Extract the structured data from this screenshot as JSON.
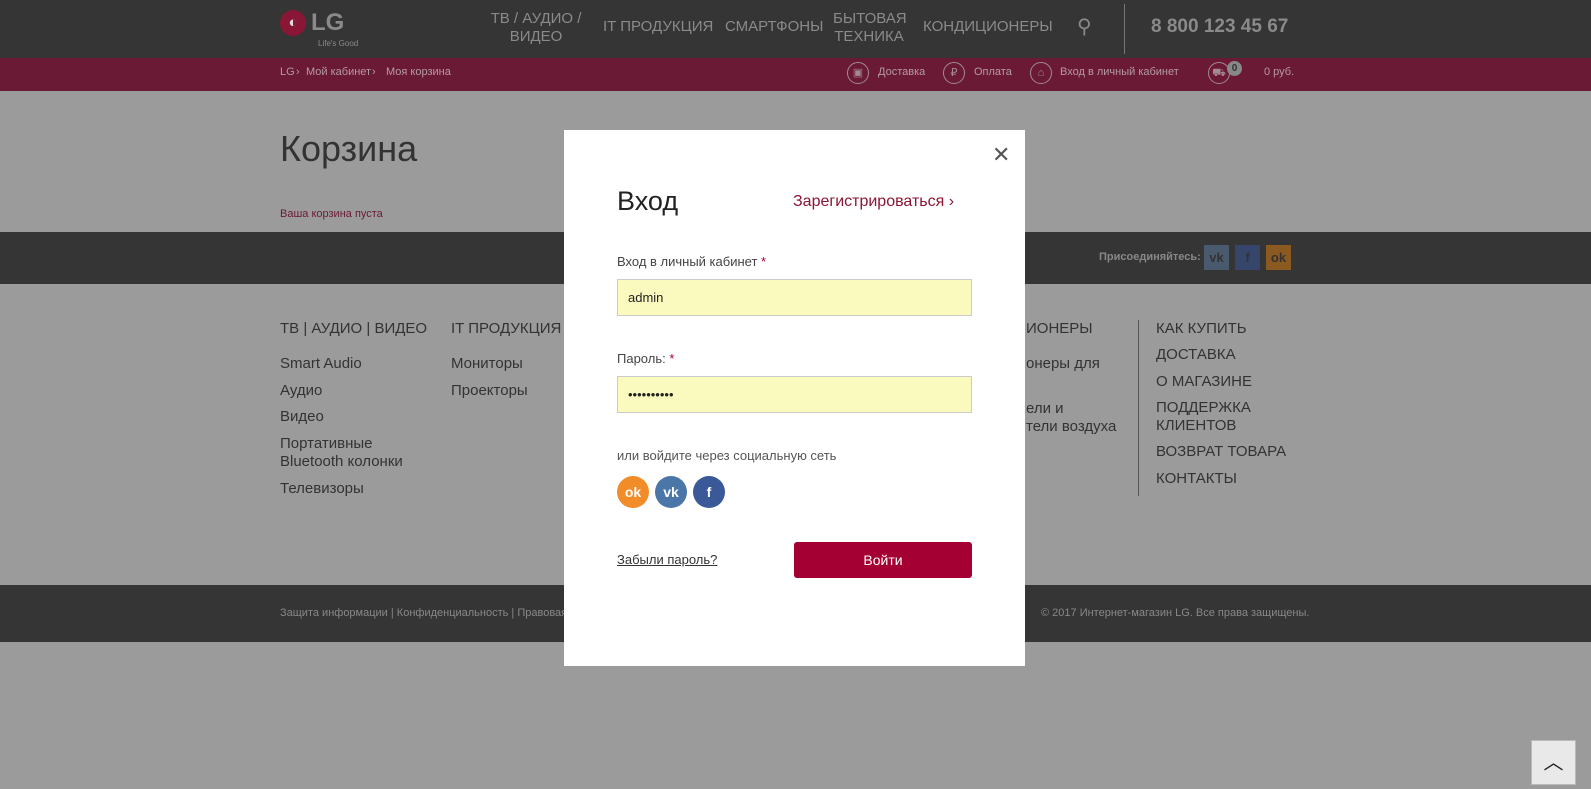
{
  "header": {
    "logo": "LG",
    "logo_tagline": "Life's Good",
    "nav": [
      "ТВ / АУДИО / ВИДЕО",
      "IT ПРОДУКЦИЯ",
      "СМАРТФОНЫ",
      "БЫТОВАЯ ТЕХНИКА",
      "КОНДИЦИОНЕРЫ"
    ],
    "phone": "8 800 123 45 67"
  },
  "breadcrumb": [
    "LG",
    "Мой кабинет",
    "Моя корзина"
  ],
  "subbar": {
    "delivery": "Доставка",
    "payment": "Оплата",
    "login": "Вход в личный кабинет",
    "cart_count": "0",
    "cart_total": "0 руб."
  },
  "page": {
    "title": "Корзина",
    "empty_msg": "Ваша корзина пуста"
  },
  "social_band": {
    "label": "Присоединяйтесь:",
    "icons": [
      "vk-icon",
      "facebook-icon",
      "odnoklassniki-icon"
    ]
  },
  "footer_cols": {
    "col1": {
      "title": "ТВ | АУДИО | ВИДЕО",
      "items": [
        "Smart Audio",
        "Аудио",
        "Видео",
        "Портативные Bluetooth колонки",
        "Телевизоры"
      ]
    },
    "col2": {
      "title": "IT ПРОДУКЦИЯ",
      "items": [
        "Мониторы",
        "Проекторы"
      ]
    },
    "col4_visible": {
      "title": "ИОНЕРЫ",
      "items": [
        "онеры для",
        "ели и",
        "тели воздуха"
      ]
    },
    "col5": [
      "КАК КУПИТЬ",
      "ДОСТАВКА",
      "О МАГАЗИНЕ",
      "ПОДДЕРЖКА КЛИЕНТОВ",
      "ВОЗВРАТ ТОВАРА",
      "КОНТАКТЫ"
    ]
  },
  "footer": {
    "links": "Защита информации | Конфиденциальность | Правовая инф",
    "copyright": "© 2017 Интернет-магазин LG. Все права защищены."
  },
  "modal": {
    "title": "Вход",
    "register": "Зарегистрироваться",
    "login_label": "Вход в личный кабинет",
    "password_label": "Пароль:",
    "required": "*",
    "login_value": "admin",
    "password_value": "••••••••••",
    "social_text": "или войдите через социальную сеть",
    "forgot": "Забыли пароль?",
    "submit": "Войти"
  },
  "colors": {
    "accent": "#a50034",
    "brand_bar": "#6a1a35",
    "input_bg": "#fafabe"
  }
}
